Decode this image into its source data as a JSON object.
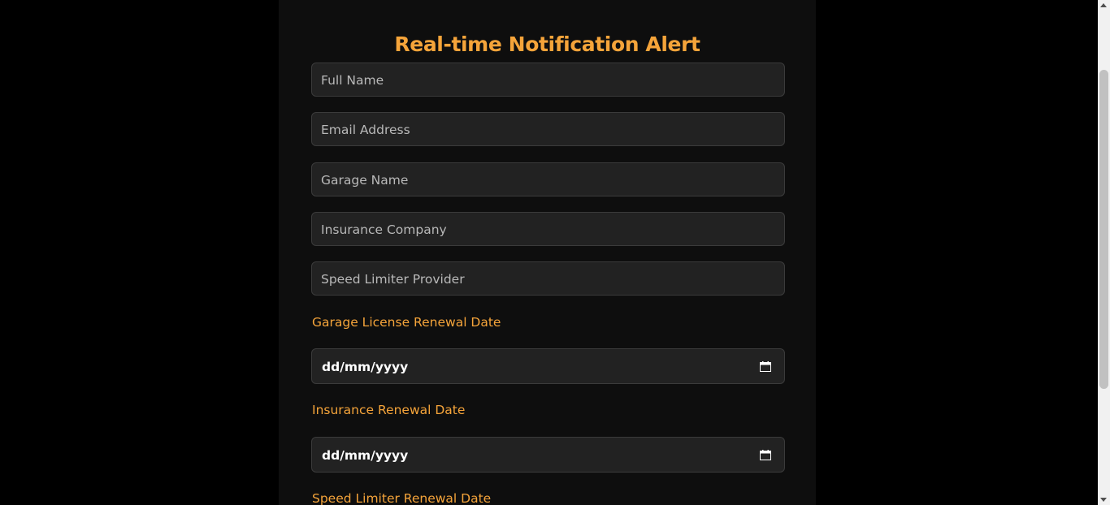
{
  "form": {
    "title": "Real-time Notification Alert",
    "fields": {
      "full_name": {
        "placeholder": "Full Name",
        "value": ""
      },
      "email": {
        "placeholder": "Email Address",
        "value": ""
      },
      "garage_name": {
        "placeholder": "Garage Name",
        "value": ""
      },
      "insurance_company": {
        "placeholder": "Insurance Company",
        "value": ""
      },
      "speed_limiter_provider": {
        "placeholder": "Speed Limiter Provider",
        "value": ""
      }
    },
    "dates": {
      "garage_license": {
        "label": "Garage License Renewal Date",
        "value": "dd/mm/yyyy"
      },
      "insurance": {
        "label": "Insurance Renewal Date",
        "value": "dd/mm/yyyy"
      },
      "speed_limiter": {
        "label": "Speed Limiter Renewal Date"
      }
    }
  },
  "theme": {
    "accent": "#f5a43a",
    "background": "#000000",
    "card": "#0e0e0e",
    "input_bg": "#222222",
    "input_border": "#3b3b3b"
  },
  "icons": {
    "calendar": "calendar-icon"
  }
}
